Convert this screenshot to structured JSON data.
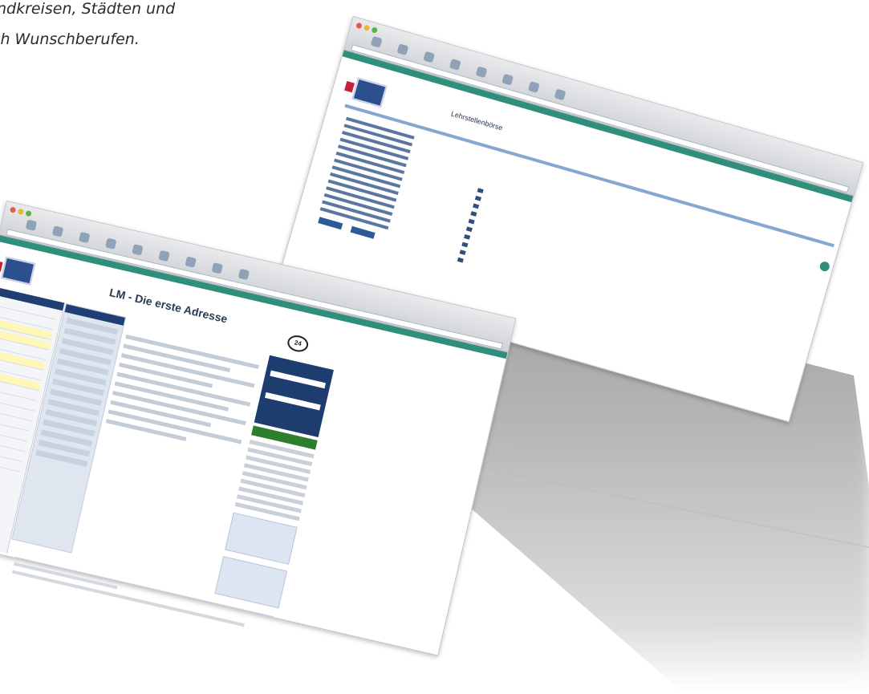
{
  "caption": {
    "line1": "ndkreisen, Städten und",
    "line2": "ch Wunschberufen."
  },
  "front_window": {
    "headline": "LM - Die erste Adresse",
    "badge": "24"
  },
  "back_window": {
    "headline": "Lehrstellenbörse"
  }
}
